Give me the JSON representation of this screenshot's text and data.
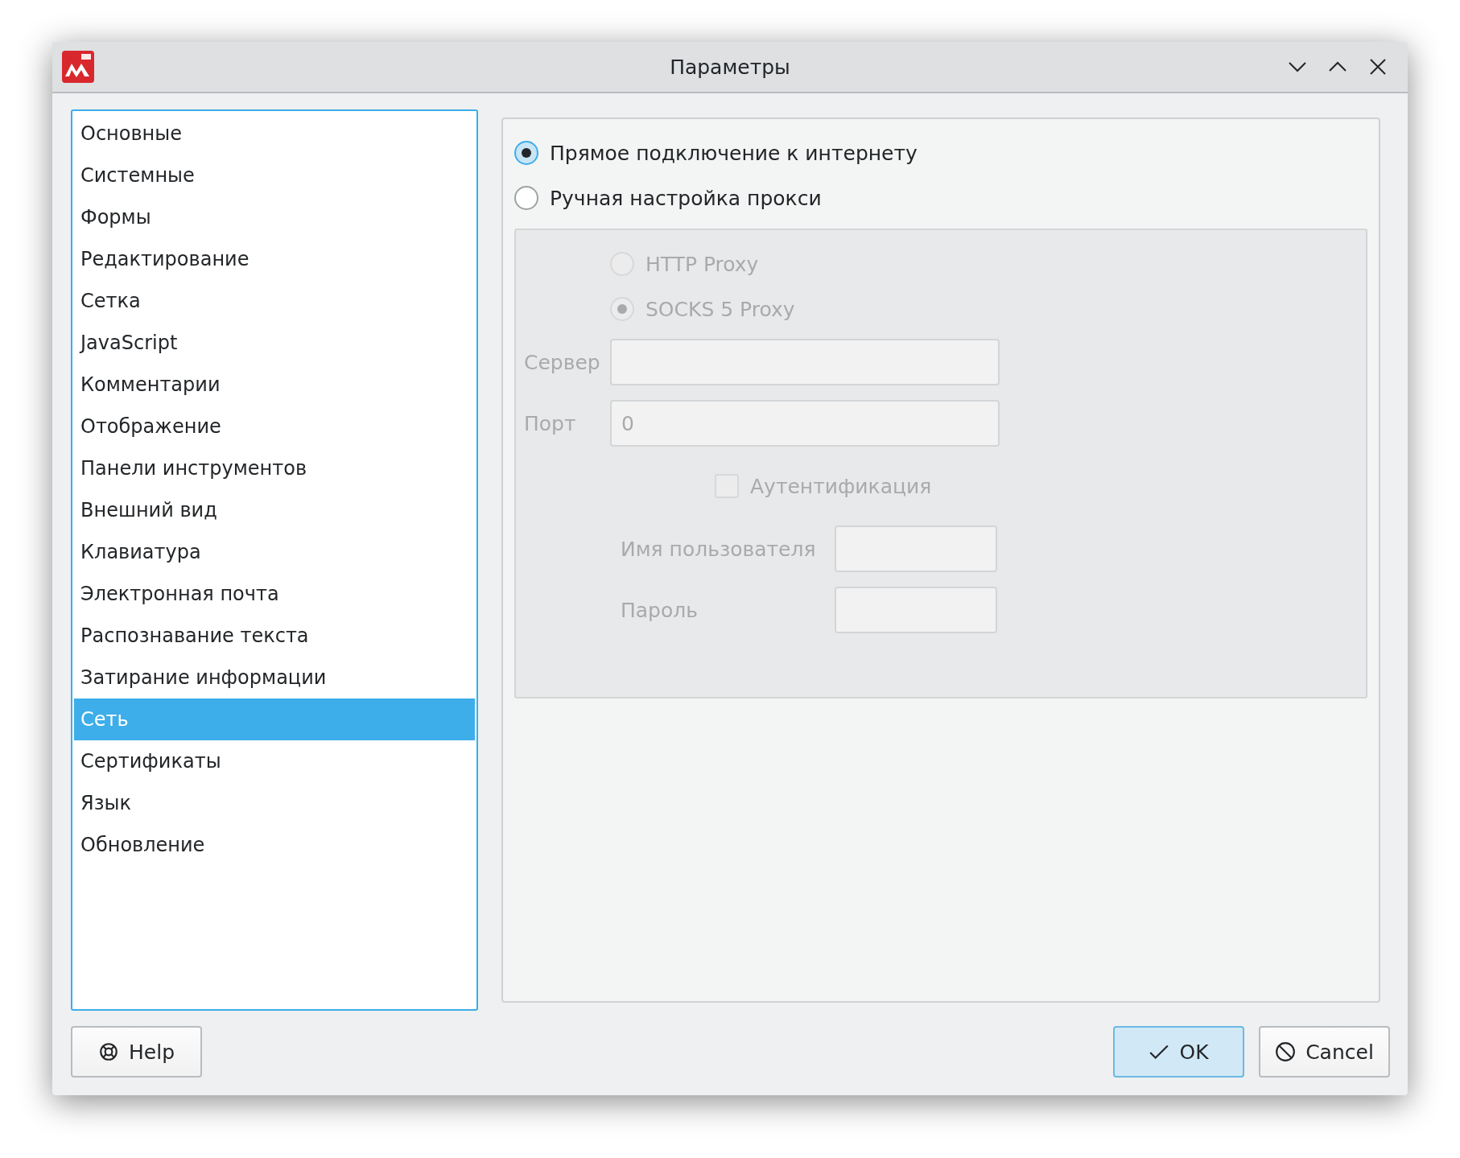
{
  "window": {
    "title": "Параметры"
  },
  "sidebar": {
    "items": [
      {
        "label": "Основные",
        "selected": false
      },
      {
        "label": "Системные",
        "selected": false
      },
      {
        "label": "Формы",
        "selected": false
      },
      {
        "label": "Редактирование",
        "selected": false
      },
      {
        "label": "Сетка",
        "selected": false
      },
      {
        "label": "JavaScript",
        "selected": false
      },
      {
        "label": "Комментарии",
        "selected": false
      },
      {
        "label": "Отображение",
        "selected": false
      },
      {
        "label": "Панели инструментов",
        "selected": false
      },
      {
        "label": "Внешний вид",
        "selected": false
      },
      {
        "label": "Клавиатура",
        "selected": false
      },
      {
        "label": "Электронная почта",
        "selected": false
      },
      {
        "label": "Распознавание текста",
        "selected": false
      },
      {
        "label": "Затирание информации",
        "selected": false
      },
      {
        "label": "Сеть",
        "selected": true
      },
      {
        "label": "Сертификаты",
        "selected": false
      },
      {
        "label": "Язык",
        "selected": false
      },
      {
        "label": "Обновление",
        "selected": false
      }
    ]
  },
  "connection": {
    "options": [
      {
        "label": "Прямое подключение к интернету",
        "selected": true
      },
      {
        "label": "Ручная настройка прокси",
        "selected": false
      }
    ]
  },
  "proxy": {
    "disabled": true,
    "types": [
      {
        "label": "HTTP Proxy",
        "selected": false
      },
      {
        "label": "SOCKS 5 Proxy",
        "selected": true
      }
    ],
    "server": {
      "label": "Сервер"
    },
    "port": {
      "label": "Порт",
      "value": "0"
    },
    "auth": {
      "label": "Аутентификация",
      "checked": false
    },
    "username": {
      "label": "Имя пользователя"
    },
    "password": {
      "label": "Пароль"
    }
  },
  "buttons": [
    {
      "kind": "help",
      "label": "Help"
    },
    {
      "kind": "ok",
      "label": "OK"
    },
    {
      "kind": "cancel",
      "label": "Cancel"
    }
  ]
}
